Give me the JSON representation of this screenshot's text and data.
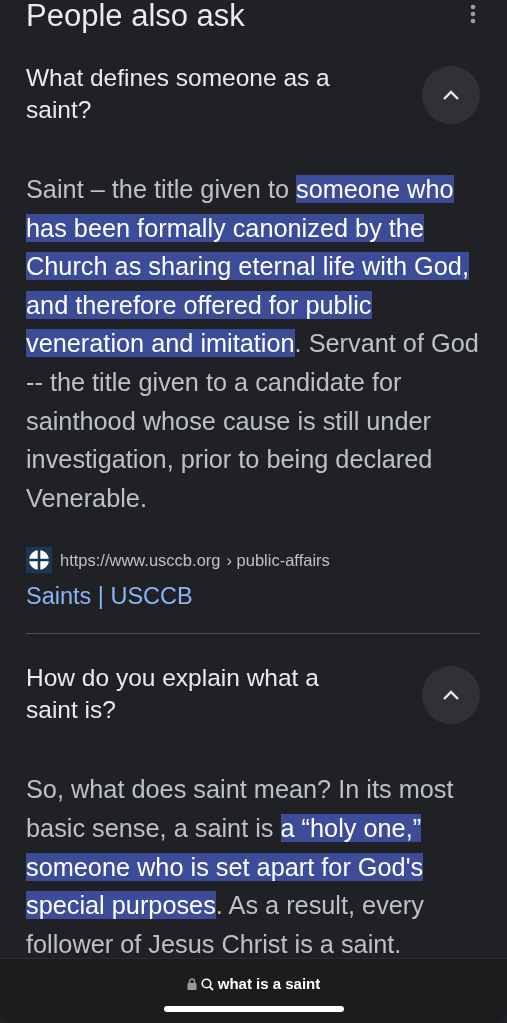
{
  "header": {
    "title": "People also ask"
  },
  "questions": [
    {
      "question": "What defines someone as a saint?",
      "expanded": true,
      "answer": [
        {
          "text": "Saint – the title given to ",
          "highlighted": false
        },
        {
          "text": "someone who has been formally canonized by the Church as sharing eternal life with God, and therefore offered for public veneration and imitation",
          "highlighted": true
        },
        {
          "text": ". Servant of God -- the title given to a candidate for sainthood whose cause is still under investigation, prior to being declared Venerable.",
          "highlighted": false
        }
      ],
      "source": {
        "url": "https://www.usccb.org",
        "path": "› public-affairs",
        "title": "Saints | USCCB"
      }
    },
    {
      "question": "How do you explain what a saint is?",
      "expanded": true,
      "answer": [
        {
          "text": "So, what does saint mean? In its most basic sense, a saint is ",
          "highlighted": false
        },
        {
          "text": "a “holy one,” someone who is set apart for God's special purposes",
          "highlighted": true
        },
        {
          "text": ". As a result, every follower of Jesus Christ is a saint.",
          "highlighted": false
        }
      ]
    }
  ],
  "address_bar": {
    "text": "what is a saint"
  }
}
